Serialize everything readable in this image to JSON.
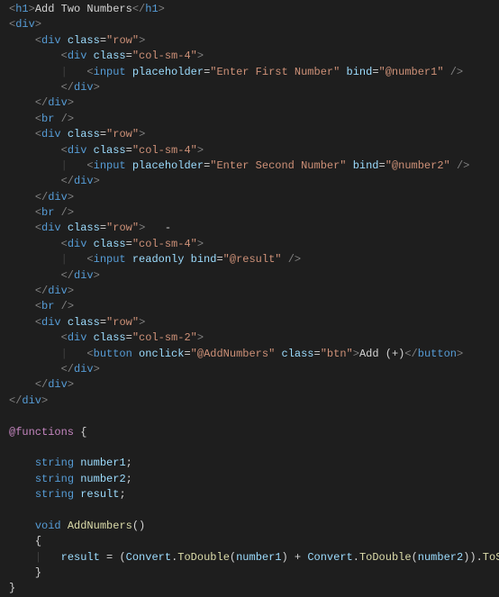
{
  "code": {
    "h1_text": "Add Two Numbers",
    "row_class": "row",
    "col_sm4": "col-sm-4",
    "col_sm2": "col-sm-2",
    "input1_placeholder": "Enter First Number",
    "input1_bind": "@number1",
    "input2_placeholder": "Enter Second Number",
    "input2_bind": "@number2",
    "result_bind": "@result",
    "button_onclick": "@AddNumbers",
    "button_class": "btn",
    "button_text": "Add (+)",
    "functions_keyword": "@functions",
    "type_string": "string",
    "type_void": "void",
    "var_number1": "number1",
    "var_number2": "number2",
    "var_result": "result",
    "method_name": "AddNumbers",
    "convert_class": "Convert",
    "todouble": "ToDouble",
    "tostring": "ToString",
    "assign_var": "result"
  }
}
